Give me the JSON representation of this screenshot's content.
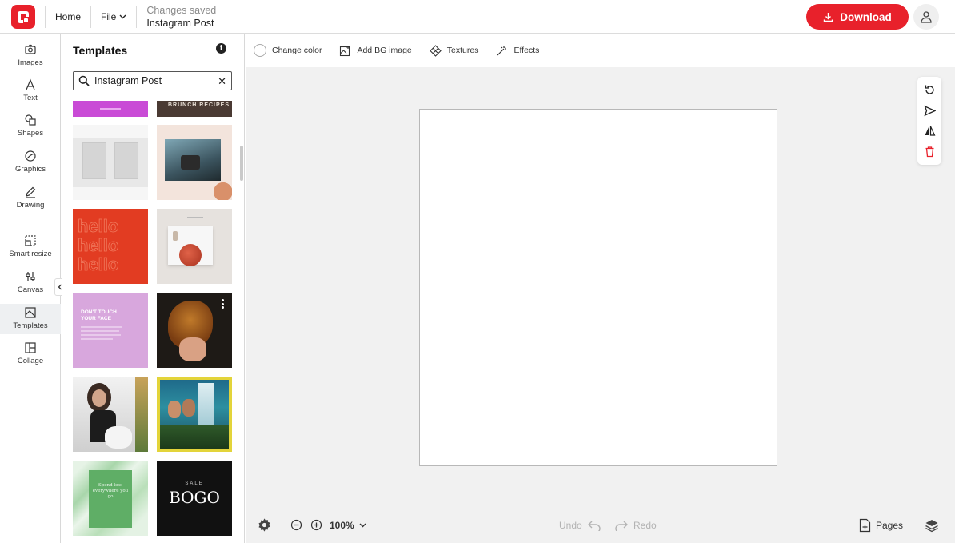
{
  "topbar": {
    "home": "Home",
    "file": "File",
    "status": "Changes saved",
    "document_name": "Instagram Post",
    "download": "Download"
  },
  "rail": {
    "items": [
      {
        "label": "Images",
        "icon": "camera-icon"
      },
      {
        "label": "Text",
        "icon": "text-icon"
      },
      {
        "label": "Shapes",
        "icon": "shapes-icon"
      },
      {
        "label": "Graphics",
        "icon": "graphics-icon"
      },
      {
        "label": "Drawing",
        "icon": "pen-icon"
      },
      {
        "label": "Smart resize",
        "icon": "resize-icon"
      },
      {
        "label": "Canvas",
        "icon": "sliders-icon"
      },
      {
        "label": "Templates",
        "icon": "templates-icon"
      },
      {
        "label": "Collage",
        "icon": "collage-icon"
      }
    ],
    "active": "Templates"
  },
  "panel": {
    "title": "Templates",
    "search_value": "Instagram Post",
    "templates": [
      {
        "name": "purple-banner",
        "text": ""
      },
      {
        "name": "brunch-recipes",
        "text": "BRUNCH RECIPES"
      },
      {
        "name": "grey-paper-collage",
        "text": ""
      },
      {
        "name": "coffee-hand-photo",
        "text": ""
      },
      {
        "name": "hello-red",
        "text": "hello hello hello"
      },
      {
        "name": "red-bowl",
        "text": ""
      },
      {
        "name": "dont-touch-your-face",
        "text": "DON'T TOUCH YOUR FACE"
      },
      {
        "name": "autumn-leaves-hands",
        "text": ""
      },
      {
        "name": "woman-portrait",
        "text": ""
      },
      {
        "name": "couple-waterfall",
        "text": ""
      },
      {
        "name": "green-marble",
        "text": "Spend less everywhere you go"
      },
      {
        "name": "sale-bogo",
        "text": "BOGO",
        "subtext": "SALE"
      }
    ]
  },
  "toolbar": {
    "change_color": "Change color",
    "add_bg_image": "Add BG image",
    "textures": "Textures",
    "effects": "Effects"
  },
  "bottom": {
    "zoom": "100%",
    "undo": "Undo",
    "redo": "Redo",
    "pages": "Pages"
  },
  "colors": {
    "brand": "#e8212b",
    "canvas_bg": "#f1f1f1"
  }
}
